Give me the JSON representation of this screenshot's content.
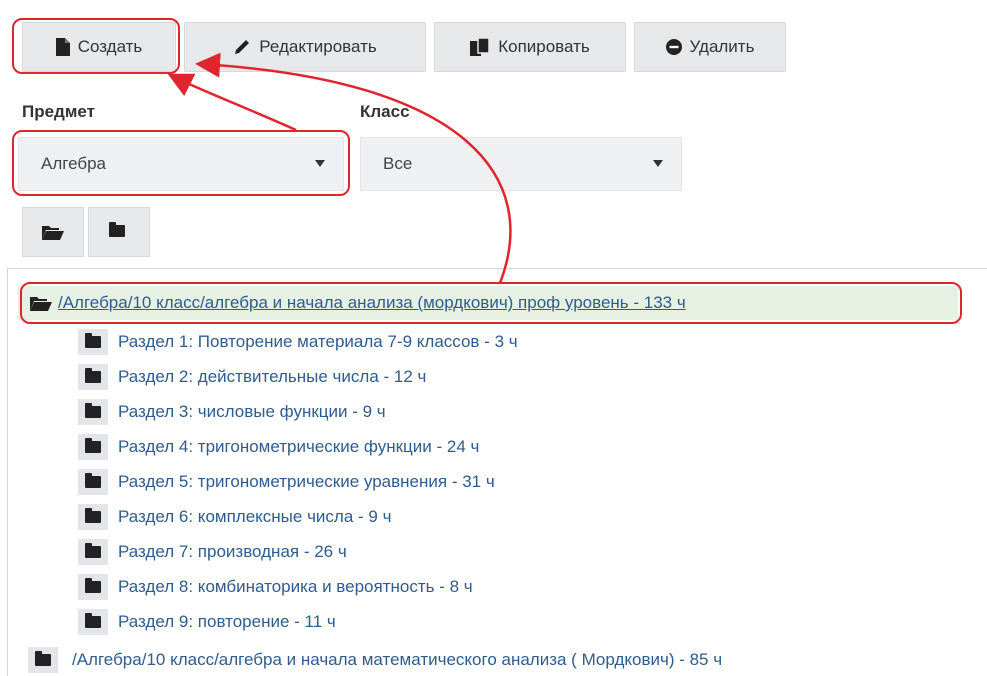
{
  "toolbar": {
    "create_label": "Создать",
    "edit_label": "Редактировать",
    "copy_label": "Копировать",
    "delete_label": "Удалить"
  },
  "filters": {
    "subject_label": "Предмет",
    "subject_value": "Алгебра",
    "class_label": "Класс",
    "class_value": "Все"
  },
  "tree": {
    "root_open": "/Алгебра/10 класс/алгебра и начала анализа (мордкович) проф уровень - 133 ч",
    "sections": [
      "Раздел 1: Повторение материала 7-9 классов - 3 ч",
      "Раздел 2: действительные числа - 12 ч",
      "Раздел 3: числовые функции - 9 ч",
      "Раздел 4: тригонометрические функции - 24 ч",
      "Раздел 5: тригонометрические уравнения - 31 ч",
      "Раздел 6: комплексные числа - 9 ч",
      "Раздел 7: производная - 26 ч",
      "Раздел 8: комбинаторика и вероятность - 8 ч",
      "Раздел 9: повторение - 11 ч"
    ],
    "root_closed": "/Алгебра/10 класс/алгебра и начала математического анализа ( Мордкович) - 85 ч"
  },
  "colors": {
    "highlight": "#e0262d",
    "link": "#2e5c8e",
    "selected_row": "#e6f1e3"
  },
  "icons": {
    "create": "file-icon",
    "edit": "pencil-icon",
    "copy": "copy-icon",
    "delete": "minus-circle-icon",
    "open_folder": "folder-open-icon",
    "closed_folder": "folder-icon"
  }
}
